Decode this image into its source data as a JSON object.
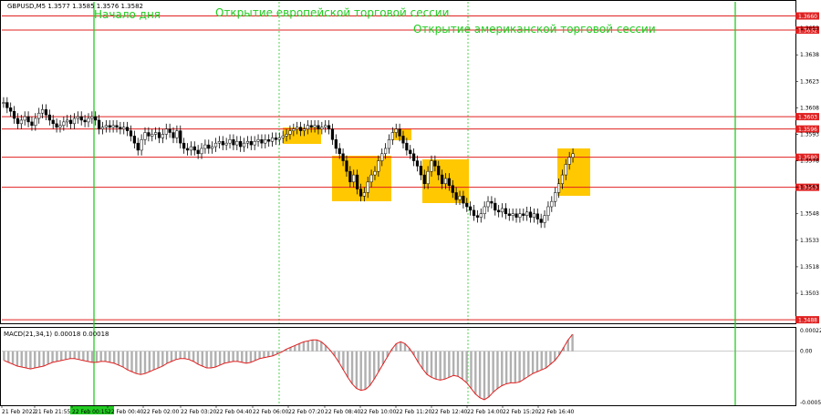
{
  "chart_data": {
    "type": "candlestick",
    "symbol_info": "GBPUSD,M5   1.3577 1.3585 1.3576 1.3582",
    "annotations": {
      "day_start": "Начало дня",
      "eu_session": "Открытие европейской торговой сессии",
      "us_session": "Открытие американской торговой сессии"
    },
    "price_ylim": [
      1.3486,
      1.3668
    ],
    "price_ticks": [
      1.3653,
      1.3638,
      1.3623,
      1.3608,
      1.3593,
      1.3578,
      1.3563,
      1.3548,
      1.3533,
      1.3518,
      1.3503
    ],
    "levels": [
      {
        "value": 1.366,
        "label": "1.3660"
      },
      {
        "value": 1.3652,
        "label": "1.3652"
      },
      {
        "value": 1.3603,
        "label": "1.3603"
      },
      {
        "value": 1.3596,
        "label": "1.3596"
      },
      {
        "value": 1.358,
        "label": "1.3580"
      },
      {
        "value": 1.3563,
        "label": "1.3563"
      },
      {
        "value": 1.3488,
        "label": "1.3488"
      }
    ],
    "x_ticks": [
      "21 Feb 2022",
      "21 Feb 21:55",
      "22 Feb 00:15",
      "22 Feb 00:40",
      "22 Feb 02:00",
      "22 Feb 03:20",
      "22 Feb 04:40",
      "22 Feb 06:00",
      "22 Feb 07:20",
      "22 Feb 08:40",
      "22 Feb 10:00",
      "22 Feb 11:20",
      "22 Feb 12:40",
      "22 Feb 14:00",
      "22 Feb 15:20",
      "22 Feb 16:40"
    ],
    "close_series": [
      1.3611,
      1.3608,
      1.3606,
      1.3602,
      1.3599,
      1.3601,
      1.3603,
      1.36,
      1.3598,
      1.3602,
      1.3605,
      1.3607,
      1.3604,
      1.3601,
      1.3599,
      1.3597,
      1.3598,
      1.36,
      1.3601,
      1.3599,
      1.3602,
      1.3603,
      1.3601,
      1.36,
      1.3602,
      1.3603,
      1.3601,
      1.3596,
      1.3597,
      1.3598,
      1.3597,
      1.3598,
      1.3597,
      1.3596,
      1.3597,
      1.3595,
      1.3592,
      1.3588,
      1.3584,
      1.359,
      1.3594,
      1.3592,
      1.3593,
      1.3594,
      1.3591,
      1.3593,
      1.3596,
      1.3594,
      1.3591,
      1.3595,
      1.3588,
      1.3585,
      1.3584,
      1.3586,
      1.3584,
      1.3582,
      1.3585,
      1.3587,
      1.3585,
      1.3586,
      1.3588,
      1.3589,
      1.3587,
      1.3588,
      1.359,
      1.3587,
      1.3589,
      1.3586,
      1.3588,
      1.3589,
      1.3587,
      1.3589,
      1.359,
      1.3588,
      1.359,
      1.3589,
      1.3591,
      1.359,
      1.3591,
      1.3592,
      1.3593,
      1.3595,
      1.3596,
      1.3597,
      1.3595,
      1.3596,
      1.3598,
      1.3597,
      1.3598,
      1.3596,
      1.3597,
      1.3598,
      1.3596,
      1.359,
      1.3585,
      1.3582,
      1.3578,
      1.3572,
      1.3566,
      1.357,
      1.3562,
      1.3558,
      1.356,
      1.3566,
      1.357,
      1.3572,
      1.3578,
      1.3582,
      1.3585,
      1.359,
      1.3594,
      1.3596,
      1.3592,
      1.3588,
      1.3584,
      1.3582,
      1.3578,
      1.3575,
      1.357,
      1.3565,
      1.3572,
      1.3578,
      1.3575,
      1.357,
      1.3565,
      1.3568,
      1.3564,
      1.356,
      1.3556,
      1.3558,
      1.3554,
      1.3552,
      1.355,
      1.3547,
      1.3546,
      1.3548,
      1.3552,
      1.3555,
      1.3554,
      1.355,
      1.3549,
      1.3551,
      1.3548,
      1.3547,
      1.3548,
      1.3546,
      1.3548,
      1.3547,
      1.3549,
      1.3546,
      1.3548,
      1.3545,
      1.3543,
      1.3547,
      1.3552,
      1.3555,
      1.356,
      1.3565,
      1.357,
      1.3576,
      1.358,
      1.3582
    ],
    "macd_title": "MACD(21,34,1) 0.00018 0.00018",
    "macd_ylim": [
      -0.00057,
      0.00024
    ],
    "macd_ticks": [
      0.00022,
      0.0,
      -0.00055
    ],
    "macd_series": [
      -0.0001,
      -0.00012,
      -0.00014,
      -0.00016,
      -0.00017,
      -0.00018,
      -0.00019,
      -0.00018,
      -0.00017,
      -0.00016,
      -0.00014,
      -0.00012,
      -0.00011,
      -0.0001,
      -9e-05,
      -8e-05,
      -8e-05,
      -9e-05,
      -0.0001,
      -0.00011,
      -0.00012,
      -0.00012,
      -0.00011,
      -0.00011,
      -0.00012,
      -0.00013,
      -0.00015,
      -0.00017,
      -0.0002,
      -0.00022,
      -0.00024,
      -0.00025,
      -0.00024,
      -0.00022,
      -0.0002,
      -0.00018,
      -0.00016,
      -0.00013,
      -0.00011,
      -9e-05,
      -8e-05,
      -8e-05,
      -9e-05,
      -0.00011,
      -0.00014,
      -0.00016,
      -0.00018,
      -0.00018,
      -0.00017,
      -0.00015,
      -0.00013,
      -0.00012,
      -0.00011,
      -0.00011,
      -0.00012,
      -0.00013,
      -0.00012,
      -0.0001,
      -8e-05,
      -7e-05,
      -6e-05,
      -5e-05,
      -3e-05,
      -1e-05,
      2e-05,
      4e-05,
      6e-05,
      8e-05,
      0.0001,
      0.00011,
      0.00012,
      0.00012,
      0.0001,
      6e-05,
      1e-05,
      -5e-05,
      -0.00012,
      -0.0002,
      -0.00028,
      -0.00035,
      -0.0004,
      -0.00042,
      -0.00041,
      -0.00037,
      -0.0003,
      -0.00022,
      -0.00014,
      -6e-05,
      2e-05,
      8e-05,
      0.0001,
      8e-05,
      3e-05,
      -4e-05,
      -0.00012,
      -0.00019,
      -0.00025,
      -0.00028,
      -0.0003,
      -0.00031,
      -0.0003,
      -0.00028,
      -0.00026,
      -0.00027,
      -0.0003,
      -0.00034,
      -0.0004,
      -0.00046,
      -0.0005,
      -0.00052,
      -0.00049,
      -0.00044,
      -0.0004,
      -0.00037,
      -0.00035,
      -0.00034,
      -0.00034,
      -0.00033,
      -0.0003,
      -0.00027,
      -0.00024,
      -0.00022,
      -0.0002,
      -0.00018,
      -0.00014,
      -0.0001,
      -4e-05,
      4e-05,
      0.00012,
      0.00018
    ],
    "colors": {
      "background": "#ffffff",
      "grid": "#cfcfcf",
      "candle": "#000000",
      "level_line": "#e02020",
      "session_line": "#22cc22",
      "highlight_box": "#ffc800",
      "macd_hist": "#b0b0b0",
      "macd_signal": "#e02020",
      "current_time_tag": "#22cc22"
    }
  }
}
